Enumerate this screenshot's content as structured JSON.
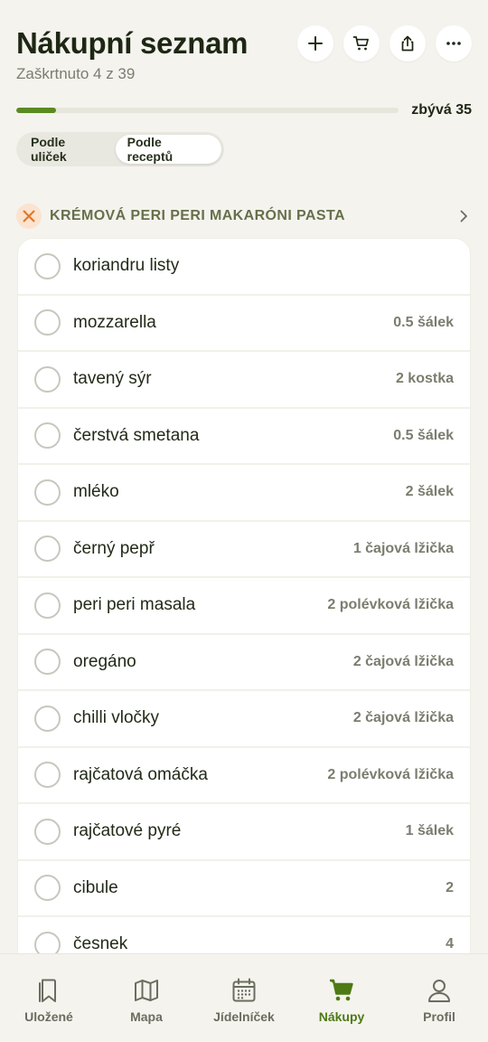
{
  "header": {
    "title": "Nákupní seznam",
    "subtitle": "Zaškrtnuto 4 z 39",
    "actions": [
      "plus-icon",
      "cart-icon",
      "share-icon",
      "more-icon"
    ]
  },
  "progress": {
    "checked": 4,
    "total": 39,
    "fraction": 0.103,
    "remaining_label": "zbývá 35",
    "color": "#5a8a1f"
  },
  "segments": {
    "aisles": "Podle uliček",
    "recipes": "Podle receptů",
    "selected": "recipes"
  },
  "section": {
    "title": "KRÉMOVÁ PERI PERI MAKARÓNI PASTA",
    "icon": "utensils-icon"
  },
  "items": [
    {
      "name": "koriandru listy",
      "qty": ""
    },
    {
      "name": "mozzarella",
      "qty": "0.5 šálek"
    },
    {
      "name": "tavený sýr",
      "qty": "2 kostka"
    },
    {
      "name": "čerstvá smetana",
      "qty": "0.5 šálek"
    },
    {
      "name": "mléko",
      "qty": "2 šálek"
    },
    {
      "name": "černý pepř",
      "qty": "1 čajová lžička"
    },
    {
      "name": "peri peri masala",
      "qty": "2 polévková lžička"
    },
    {
      "name": "oregáno",
      "qty": "2 čajová lžička"
    },
    {
      "name": "chilli vločky",
      "qty": "2 čajová lžička"
    },
    {
      "name": "rajčatová omáčka",
      "qty": "2 polévková lžička"
    },
    {
      "name": "rajčatové pyré",
      "qty": "1 šálek"
    },
    {
      "name": "cibule",
      "qty": "2"
    },
    {
      "name": "česnek",
      "qty": "4"
    }
  ],
  "tabs": [
    {
      "label": "Uložené",
      "icon": "bookmark-icon"
    },
    {
      "label": "Mapa",
      "icon": "map-icon"
    },
    {
      "label": "Jídelníček",
      "icon": "calendar-icon"
    },
    {
      "label": "Nákupy",
      "icon": "cart-icon",
      "active": true
    },
    {
      "label": "Profil",
      "icon": "user-icon"
    }
  ],
  "colors": {
    "accent": "#4d7a15",
    "background": "#f4f3ee",
    "section_title": "#66704a"
  }
}
